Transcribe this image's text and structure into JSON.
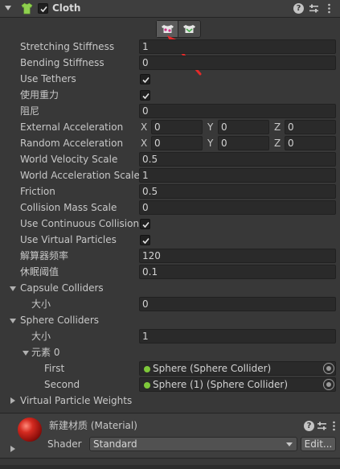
{
  "component": {
    "title": "Cloth",
    "enabled": true,
    "icons": [
      "cloth-shirt-icon",
      "help-icon",
      "preset-icon",
      "kebab-menu-icon"
    ]
  },
  "toolbar": {
    "buttons": [
      {
        "name": "edit-constraints-tool",
        "active": true
      },
      {
        "name": "edit-self-collision-tool",
        "active": false
      }
    ]
  },
  "properties": {
    "stretching_stiffness": {
      "label": "Stretching Stiffness",
      "value": "1"
    },
    "bending_stiffness": {
      "label": "Bending Stiffness",
      "value": "0"
    },
    "use_tethers": {
      "label": "Use Tethers",
      "checked": true
    },
    "use_gravity": {
      "label": "使用重力",
      "checked": true
    },
    "damping": {
      "label": "阻尼",
      "value": "0"
    },
    "external_acceleration": {
      "label": "External Acceleration",
      "x": "0",
      "y": "0",
      "z": "0"
    },
    "random_acceleration": {
      "label": "Random Acceleration",
      "x": "0",
      "y": "0",
      "z": "0"
    },
    "world_velocity_scale": {
      "label": "World Velocity Scale",
      "value": "0.5"
    },
    "world_acceleration_scale": {
      "label": "World Acceleration Scale",
      "value": "1"
    },
    "friction": {
      "label": "Friction",
      "value": "0.5"
    },
    "collision_mass_scale": {
      "label": "Collision Mass Scale",
      "value": "0"
    },
    "use_continuous_collision": {
      "label": "Use Continuous Collision",
      "checked": true
    },
    "use_virtual_particles": {
      "label": "Use Virtual Particles",
      "checked": true
    },
    "solver_frequency": {
      "label": "解算器频率",
      "value": "120"
    },
    "sleep_threshold": {
      "label": "休眠阈值",
      "value": "0.1"
    }
  },
  "axis_labels": {
    "x": "X",
    "y": "Y",
    "z": "Z"
  },
  "capsule_colliders": {
    "label": "Capsule Colliders",
    "size_label": "大小",
    "size": "0"
  },
  "sphere_colliders": {
    "label": "Sphere Colliders",
    "size_label": "大小",
    "size": "1",
    "element_label": "元素 0",
    "first_label": "First",
    "first_value": "Sphere (Sphere Collider)",
    "second_label": "Second",
    "second_value": "Sphere (1) (Sphere Collider)"
  },
  "virtual_particle_weights": {
    "label": "Virtual Particle Weights"
  },
  "material": {
    "title": "新建材质 (Material)",
    "shader_label": "Shader",
    "shader_value": "Standard",
    "edit_label": "Edit...",
    "color_accent": "#d42a20"
  }
}
